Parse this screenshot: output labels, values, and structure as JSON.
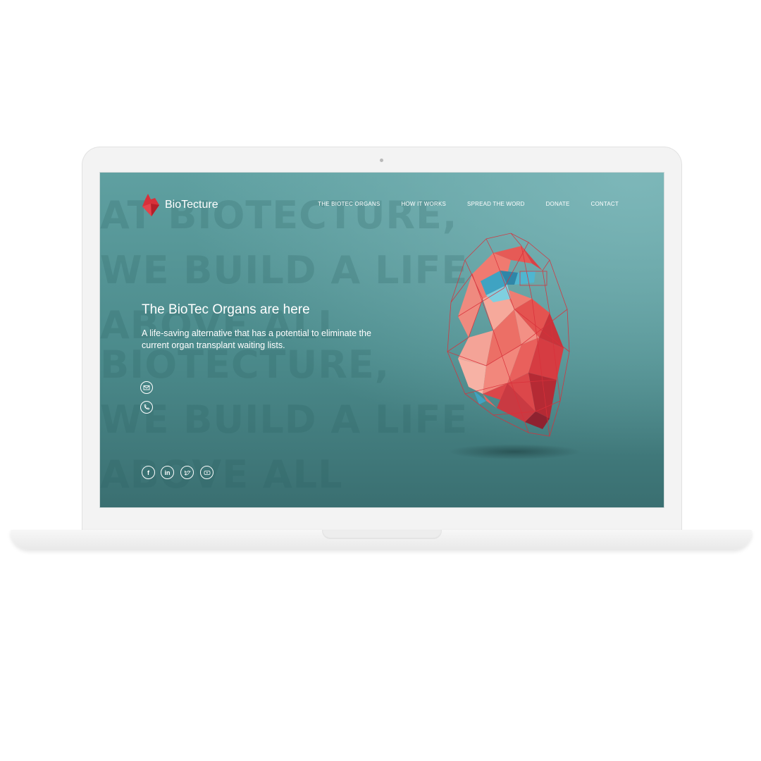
{
  "brand": {
    "name": "BioTecture",
    "accent": "#d8303a"
  },
  "nav": {
    "items": [
      "THE BIOTEC ORGANS",
      "HOW IT WORKS",
      "SPREAD THE WORD",
      "DONATE",
      "CONTACT"
    ]
  },
  "hero": {
    "headline": "The BioTec Organs are here",
    "subtitle": "A life-saving alternative that has a potential to eliminate the current organ transplant waiting lists."
  },
  "background_text": {
    "block_1": "AT BIOTECTURE,\nWE BUILD A LIFE\nABOVE ALL",
    "block_2": "BIOTECTURE,\nWE BUILD A LIFE\nABOVE ALL"
  },
  "contact_icons": [
    "mail-icon",
    "phone-icon"
  ],
  "social_icons": [
    "facebook-icon",
    "linkedin-icon",
    "twitter-icon",
    "youtube-icon"
  ],
  "colors": {
    "screen_bg": "#4f8f90",
    "heart_red": "#e8474c",
    "heart_blue": "#3fa3c2"
  }
}
